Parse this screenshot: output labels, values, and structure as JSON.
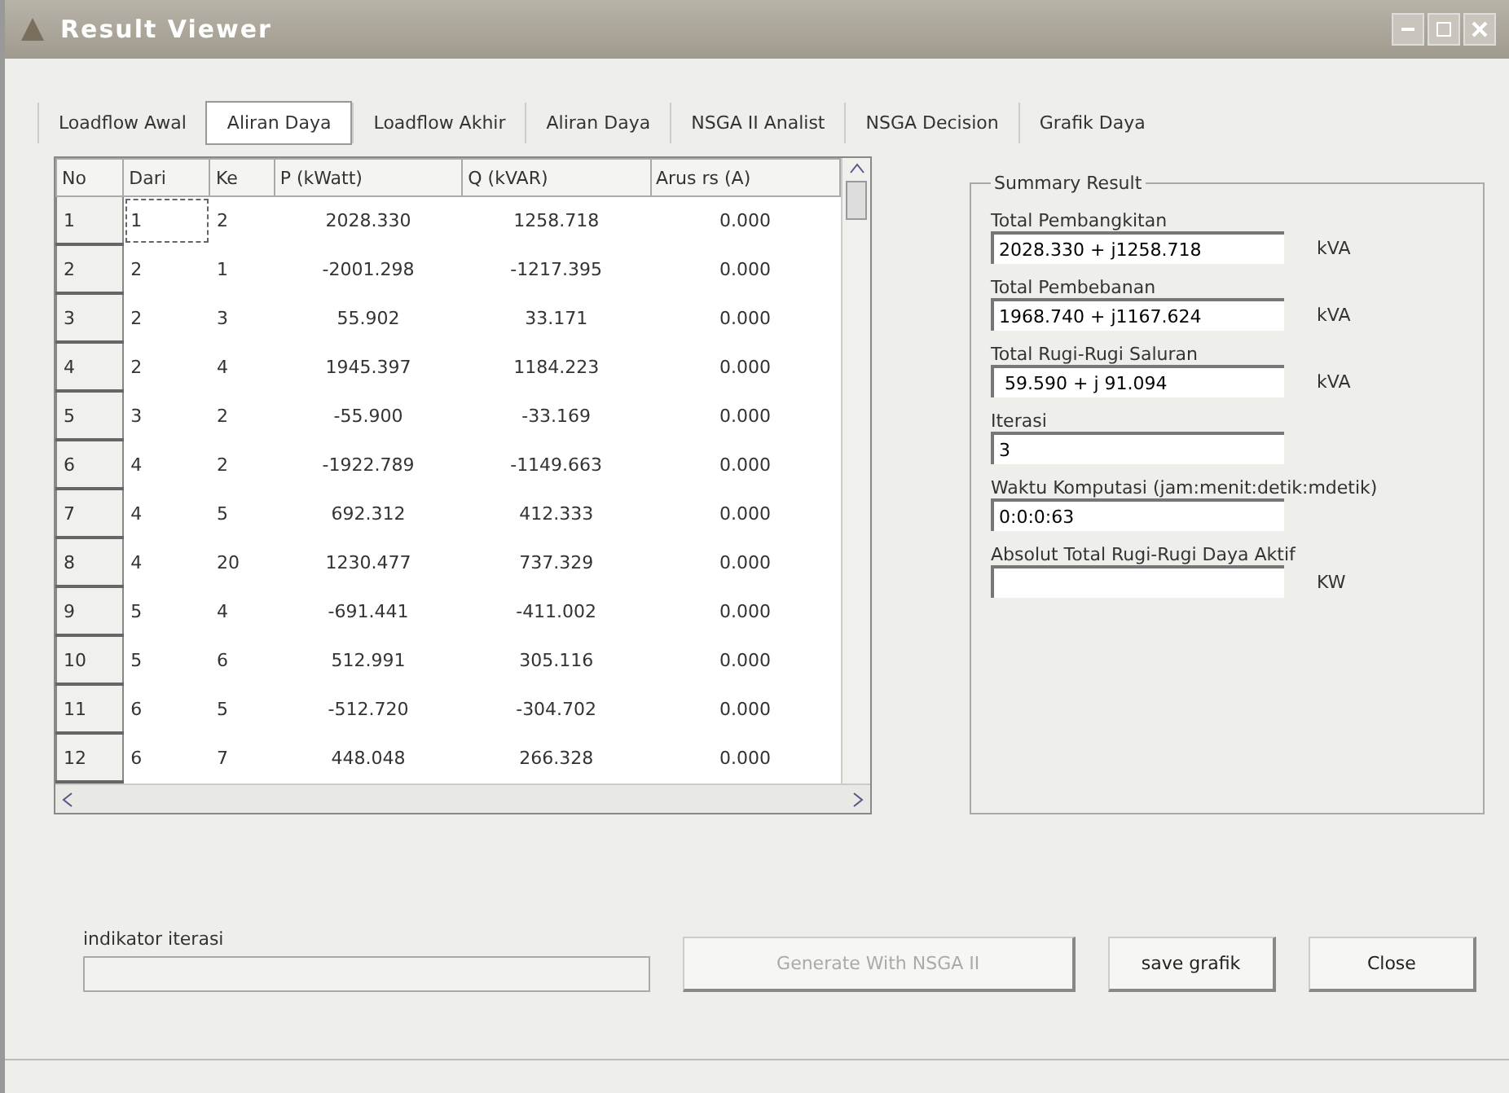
{
  "window": {
    "title": "Result Viewer"
  },
  "tabs": [
    {
      "label": "Loadflow Awal",
      "selected": false
    },
    {
      "label": "Aliran Daya",
      "selected": true
    },
    {
      "label": "Loadflow Akhir",
      "selected": false
    },
    {
      "label": "Aliran Daya",
      "selected": false
    },
    {
      "label": "NSGA II Analist",
      "selected": false
    },
    {
      "label": "NSGA Decision",
      "selected": false
    },
    {
      "label": "Grafik Daya",
      "selected": false
    }
  ],
  "table": {
    "columns": [
      "No",
      "Dari",
      "Ke",
      "P (kWatt)",
      "Q (kVAR)",
      "Arus rs (A)"
    ],
    "rows": [
      {
        "cells": [
          "1",
          "1",
          "2",
          "2028.330",
          "1258.718",
          "0.000"
        ],
        "focused": [
          false,
          true,
          false,
          false,
          false,
          false
        ]
      },
      {
        "cells": [
          "2",
          "2",
          "1",
          "-2001.298",
          "-1217.395",
          "0.000"
        ]
      },
      {
        "cells": [
          "3",
          "2",
          "3",
          "55.902",
          "33.171",
          "0.000"
        ]
      },
      {
        "cells": [
          "4",
          "2",
          "4",
          "1945.397",
          "1184.223",
          "0.000"
        ]
      },
      {
        "cells": [
          "5",
          "3",
          "2",
          "-55.900",
          "-33.169",
          "0.000"
        ]
      },
      {
        "cells": [
          "6",
          "4",
          "2",
          "-1922.789",
          "-1149.663",
          "0.000"
        ]
      },
      {
        "cells": [
          "7",
          "4",
          "5",
          "692.312",
          "412.333",
          "0.000"
        ]
      },
      {
        "cells": [
          "8",
          "4",
          "20",
          "1230.477",
          "737.329",
          "0.000"
        ]
      },
      {
        "cells": [
          "9",
          "5",
          "4",
          "-691.441",
          "-411.002",
          "0.000"
        ]
      },
      {
        "cells": [
          "10",
          "5",
          "6",
          "512.991",
          "305.116",
          "0.000"
        ]
      },
      {
        "cells": [
          "11",
          "6",
          "5",
          "-512.720",
          "-304.702",
          "0.000"
        ]
      },
      {
        "cells": [
          "12",
          "6",
          "7",
          "448.048",
          "266.328",
          "0.000"
        ]
      }
    ]
  },
  "summary": {
    "title": "Summary Result",
    "fields": [
      {
        "label": "Total Pembangkitan",
        "value": "2028.330 + j1258.718",
        "unit": "kVA"
      },
      {
        "label": "Total Pembebanan",
        "value": "1968.740 + j1167.624",
        "unit": "kVA"
      },
      {
        "label": "Total Rugi-Rugi Saluran",
        "value": " 59.590 + j 91.094",
        "unit": "kVA"
      },
      {
        "label": "Iterasi",
        "value": "3"
      },
      {
        "label": "Waktu Komputasi (jam:menit:detik:mdetik)",
        "value": "0:0:0:63"
      },
      {
        "label": "Absolut Total Rugi-Rugi Daya Aktif",
        "unit": "KW"
      }
    ]
  },
  "progress": {
    "label": "indikator iterasi"
  },
  "buttons": [
    {
      "label": "Generate With NSGA II",
      "disabled": true
    },
    {
      "label": "save grafik",
      "disabled": false
    },
    {
      "label": "Close",
      "disabled": false
    }
  ]
}
